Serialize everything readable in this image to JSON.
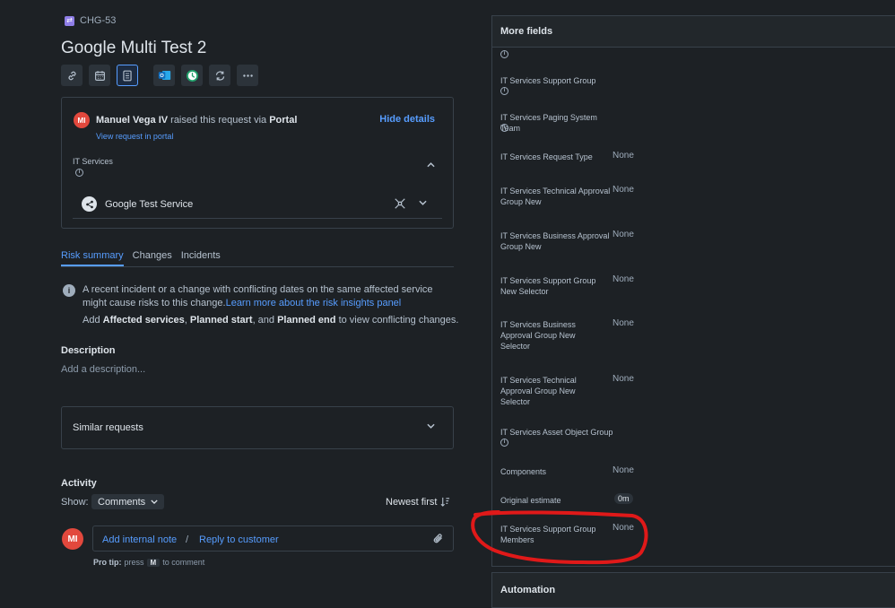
{
  "issue": {
    "key": "CHG-53",
    "title": "Google Multi Test 2"
  },
  "toolbar_icons": [
    "link-icon",
    "calendar-icon",
    "form-icon",
    "outlook-icon",
    "clock-icon",
    "sync-icon",
    "more-icon"
  ],
  "request_card": {
    "avatar_initials": "MI",
    "requester": "Manuel Vega IV",
    "raised_text": "raised this request via",
    "channel": "Portal",
    "hide_details": "Hide details",
    "view_portal": "View request in portal",
    "it_services_label": "IT Services",
    "service_name": "Google Test Service"
  },
  "tabs": [
    {
      "label": "Risk summary",
      "active": true
    },
    {
      "label": "Changes",
      "active": false
    },
    {
      "label": "Incidents",
      "active": false
    }
  ],
  "risk": {
    "text": "A recent incident or a change with conflicting dates on the same affected service might cause risks to this change.",
    "link": "Learn more about the risk insights panel",
    "line2_pre": "Add",
    "line2_b1": "Affected services",
    "line2_sep1": ",",
    "line2_b2": "Planned start",
    "line2_sep2": ", and",
    "line2_b3": "Planned end",
    "line2_post": "to view conflicting changes."
  },
  "description": {
    "heading": "Description",
    "placeholder": "Add a description..."
  },
  "similar": {
    "label": "Similar requests"
  },
  "activity": {
    "heading": "Activity",
    "show_label": "Show:",
    "show_value": "Comments",
    "sort_label": "Newest first",
    "avatar_initials": "MI",
    "internal_note": "Add internal note",
    "slash": "/",
    "reply": "Reply to customer",
    "protip_label": "Pro tip:",
    "protip_press": "press",
    "protip_key": "M",
    "protip_post": "to comment"
  },
  "more_fields": {
    "heading": "More fields",
    "fields": [
      {
        "label": "IT Services Support Group",
        "value": ""
      },
      {
        "label": "IT Services Paging System Team",
        "value": ""
      },
      {
        "label": "IT Services Request Type",
        "value": "None"
      },
      {
        "label": "IT Services Technical Approval Group New",
        "value": "None"
      },
      {
        "label": "IT Services Business Approval Group New",
        "value": "None"
      },
      {
        "label": "IT Services Support Group New Selector",
        "value": "None"
      },
      {
        "label": "IT Services Business Approval Group New Selector",
        "value": "None"
      },
      {
        "label": "IT Services Technical Approval Group New Selector",
        "value": "None"
      },
      {
        "label": "IT Services Asset Object Group",
        "value": ""
      },
      {
        "label": "Components",
        "value": "None"
      },
      {
        "label": "Original estimate",
        "value": "0m"
      },
      {
        "label": "IT Services Support Group Members",
        "value": "None"
      }
    ]
  },
  "automation": {
    "heading": "Automation"
  },
  "colors": {
    "background": "#1d2125",
    "accent": "#579dff",
    "annotation": "#e01919"
  }
}
